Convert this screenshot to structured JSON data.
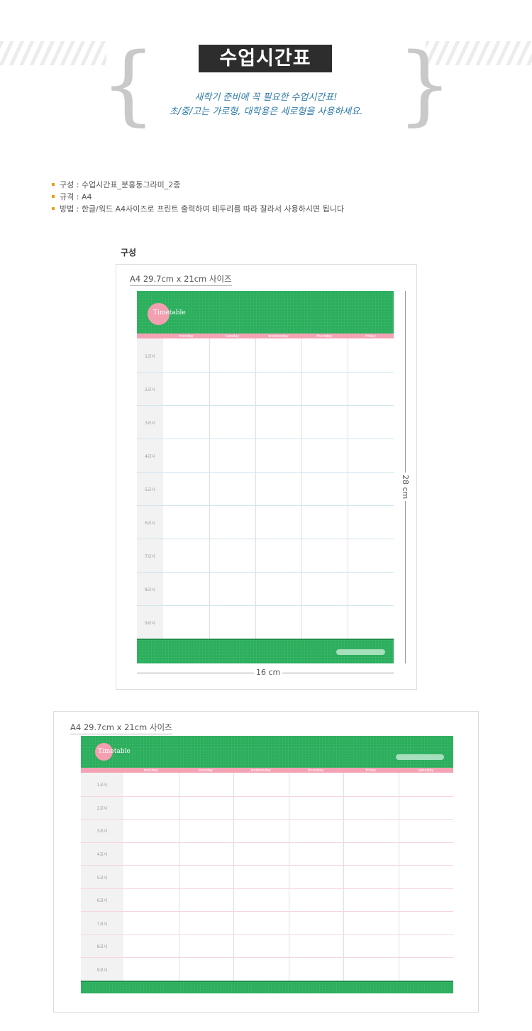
{
  "header": {
    "title": "수업시간표",
    "subtitle_line1": "새학기 준비에 꼭 필요한 수업시간표!",
    "subtitle_line2": "초/중/고는 가로형, 대학용은 세로형을 사용하세요."
  },
  "info": [
    "구성 : 수업시간표_분홍동그라미_2종",
    "규격 : A4",
    "방법 : 한글/워드 A4사이즈로 프린트 출력하여 테두리를 따라 잘라서 사용하시면 됩니다"
  ],
  "section_label": "구성",
  "vertical_sheet": {
    "size_label": "A4 29.7cm x 21cm 사이즈",
    "badge_text": "Timetable",
    "days": [
      "monday",
      "tuesday",
      "wednesday",
      "thursday",
      "friday"
    ],
    "periods": [
      "1교시",
      "2교시",
      "3교시",
      "4교시",
      "5교시",
      "6교시",
      "7교시",
      "8교시",
      "9교시"
    ],
    "height_dim": "28 cm",
    "width_dim": "16 cm"
  },
  "horizontal_sheet": {
    "size_label": "A4 29.7cm x 21cm 사이즈",
    "badge_text": "Timetable",
    "days": [
      "monday",
      "tuesday",
      "wednesday",
      "thursday",
      "friday",
      "saturday"
    ],
    "periods": [
      "1교시",
      "2교시",
      "3교시",
      "4교시",
      "5교시",
      "6교시",
      "7교시",
      "8교시",
      "9교시"
    ]
  },
  "colors": {
    "green": "#2aae5c",
    "pink": "#f4a3b5",
    "title_bg": "#2d2d2d",
    "subtitle": "#2f7aa8",
    "bullet": "#e3a317"
  }
}
